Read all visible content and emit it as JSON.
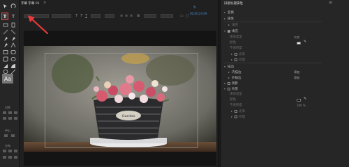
{
  "document": {
    "tab_title": "字幕 字幕 01",
    "tab_close": "≡"
  },
  "toolbar": {
    "timecode": "00;00;24;09"
  },
  "tool_sections": {
    "align": "对齐",
    "center": "中心",
    "distribute": "分布"
  },
  "tools": {
    "text_tool_glyph": "T",
    "vertical_text_glyph": "T",
    "area_text_glyph": "Aa"
  },
  "photo": {
    "basket_label": "Garden"
  },
  "panel": {
    "title": "旧版标题属性",
    "menu": "≡",
    "rows": {
      "transform": "变换",
      "properties": "属性",
      "style_placeholder": "填充",
      "fill": "填充",
      "fill_type": "填充类型",
      "fill_type_val": "实底",
      "color": "颜色",
      "opacity": "不透明度",
      "sheen": "光泽",
      "texture": "纹理",
      "strokes": "描边",
      "inner_strokes": "内描边",
      "outer_strokes": "外描边",
      "add": "添加",
      "shadow": "阴影",
      "background": "背景",
      "bg_fill_type": "填充类型",
      "bg_color": "颜色",
      "bg_opacity": "不透明度",
      "bg_opacity_val": "100 %",
      "bg_sheen": "光泽",
      "bg_texture": "纹理"
    }
  },
  "colors": {
    "accent": "#3f8fd8",
    "selection": "#e84545",
    "panel_bg": "#262626"
  }
}
